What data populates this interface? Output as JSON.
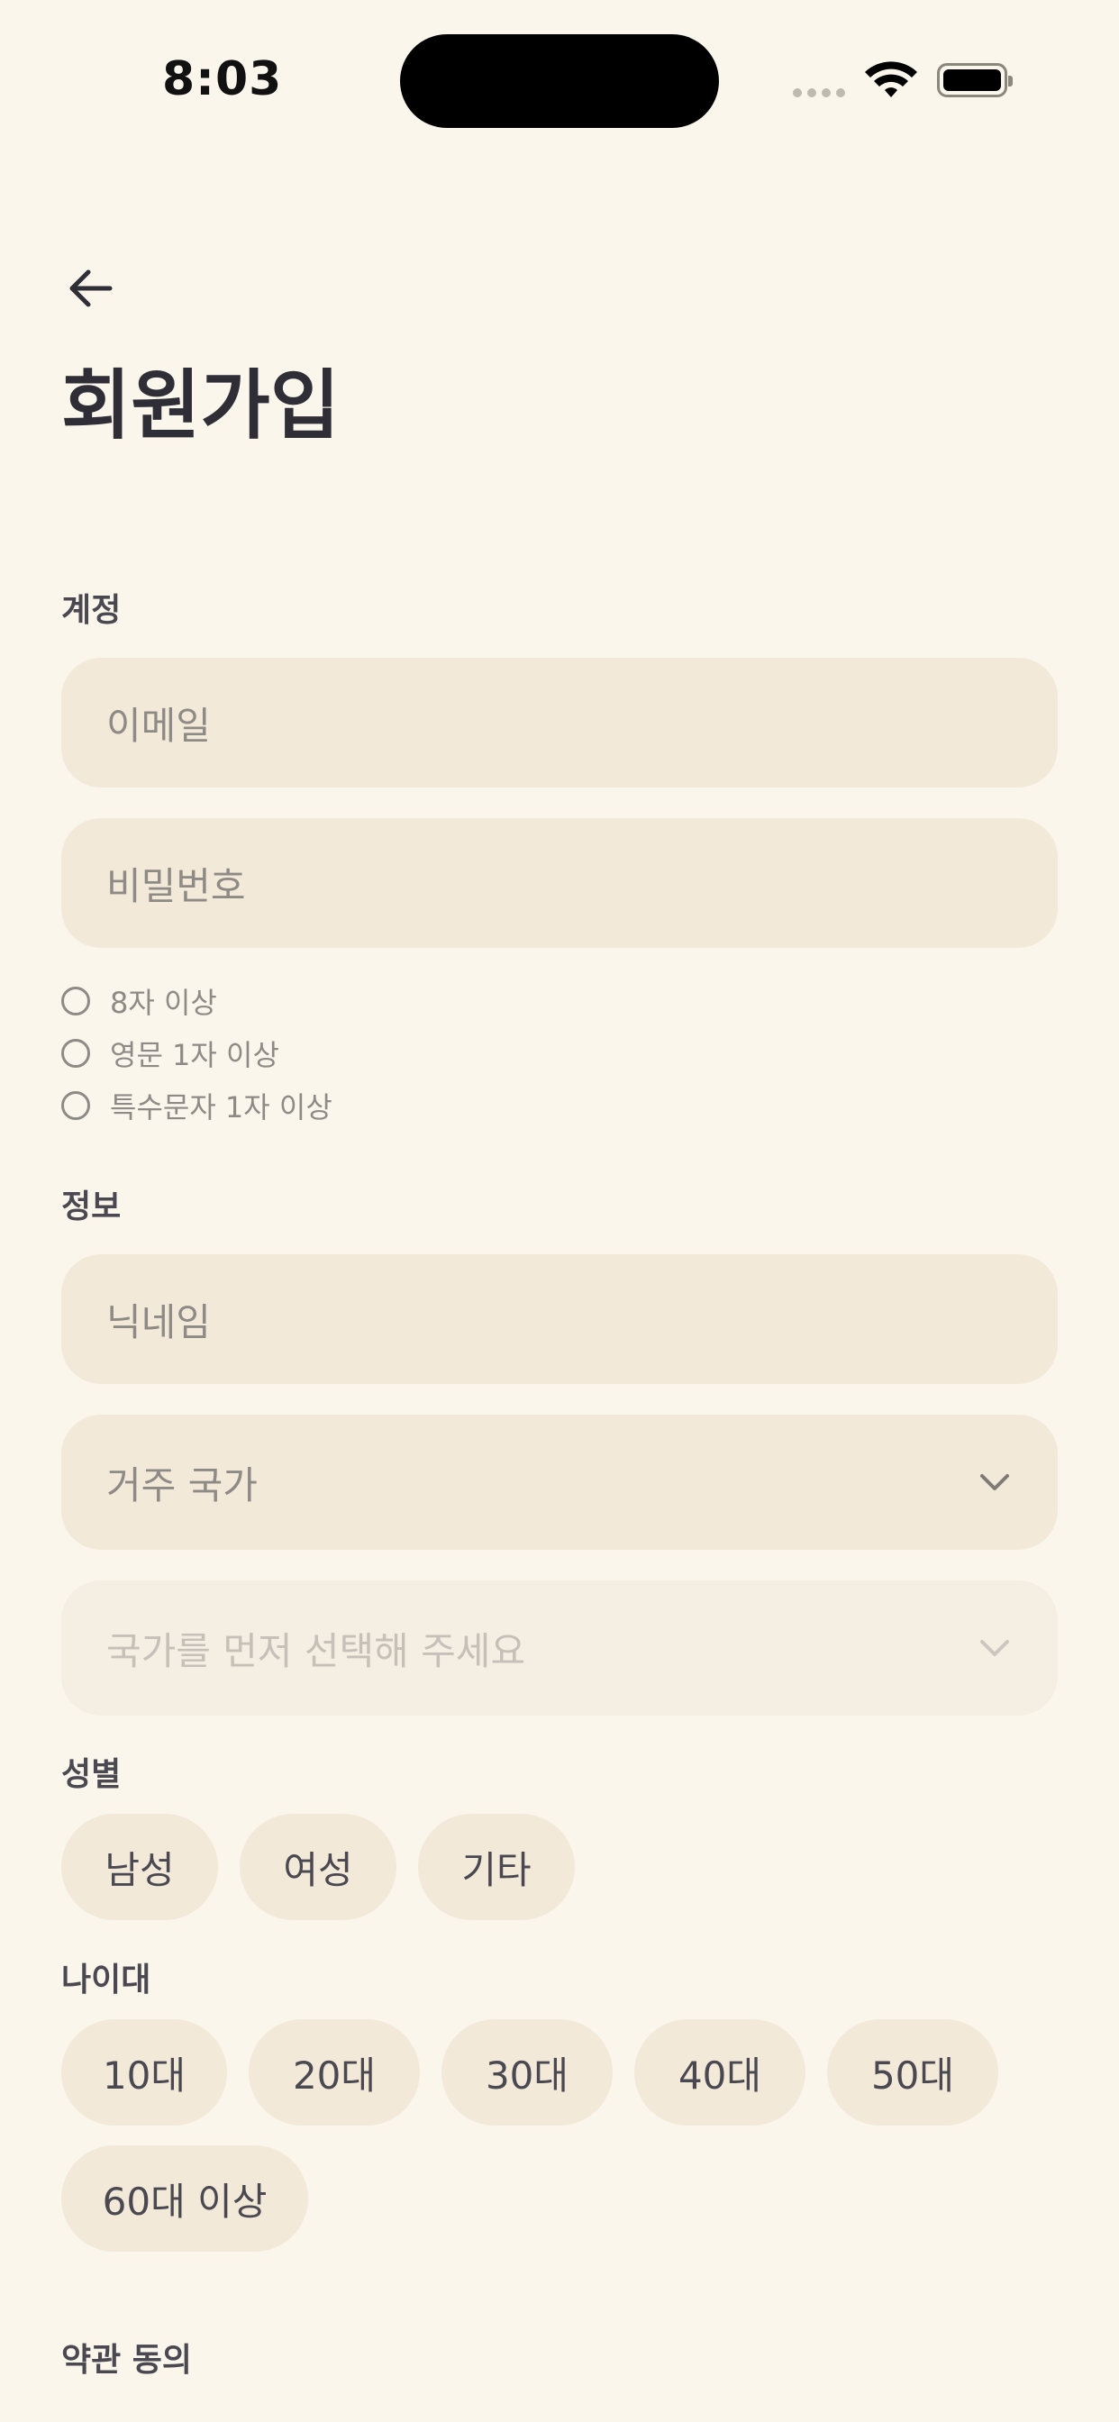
{
  "status_bar": {
    "time": "8:03"
  },
  "page": {
    "title": "회원가입"
  },
  "account": {
    "section_label": "계정",
    "email_placeholder": "이메일",
    "password_placeholder": "비밀번호",
    "rules": [
      "8자 이상",
      "영문 1자 이상",
      "특수문자 1자 이상"
    ]
  },
  "info": {
    "section_label": "정보",
    "nickname_placeholder": "닉네임",
    "country_placeholder": "거주 국가",
    "region_placeholder": "국가를 먼저 선택해 주세요"
  },
  "gender": {
    "section_label": "성별",
    "options": [
      "남성",
      "여성",
      "기타"
    ]
  },
  "age": {
    "section_label": "나이대",
    "options": [
      "10대",
      "20대",
      "30대",
      "40대",
      "50대",
      "60대 이상"
    ]
  },
  "terms": {
    "section_label": "약관 동의"
  },
  "colors": {
    "background": "#FAF6EC",
    "field": "#F3E9D9",
    "text_primary": "#2F2D36",
    "placeholder": "#8E8A86"
  }
}
